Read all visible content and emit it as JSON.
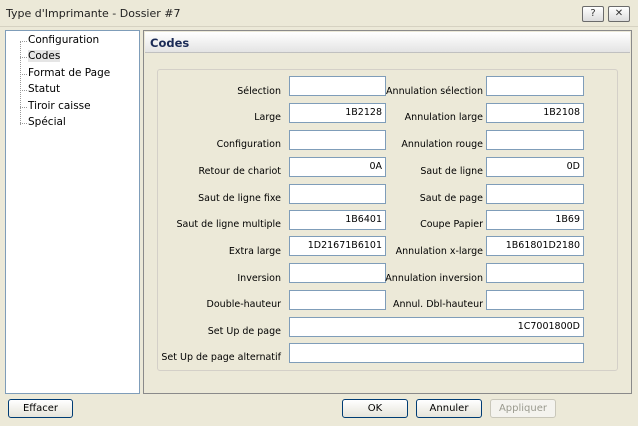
{
  "window": {
    "title": "Type d'Imprimante - Dossier #7",
    "help_label": "?",
    "close_label": "✕"
  },
  "tree": {
    "items": [
      "Configuration",
      "Codes",
      "Format de Page",
      "Statut",
      "Tiroir caisse",
      "Spécial"
    ]
  },
  "panel": {
    "title": "Codes"
  },
  "fields": {
    "selection": {
      "label": "Sélection",
      "value": ""
    },
    "annulation_selection": {
      "label": "Annulation sélection",
      "value": ""
    },
    "large": {
      "label": "Large",
      "value": "1B2128"
    },
    "annulation_large": {
      "label": "Annulation large",
      "value": "1B2108"
    },
    "configuration": {
      "label": "Configuration",
      "value": ""
    },
    "annulation_rouge": {
      "label": "Annulation rouge",
      "value": ""
    },
    "retour_chariot": {
      "label": "Retour de chariot",
      "value": "0A"
    },
    "saut_ligne": {
      "label": "Saut de ligne",
      "value": "0D"
    },
    "saut_ligne_fixe": {
      "label": "Saut de ligne fixe",
      "value": ""
    },
    "saut_page": {
      "label": "Saut de page",
      "value": ""
    },
    "saut_ligne_multiple": {
      "label": "Saut de ligne multiple",
      "value": "1B6401"
    },
    "coupe_papier": {
      "label": "Coupe Papier",
      "value": "1B69"
    },
    "extra_large": {
      "label": "Extra large",
      "value": "1D21671B6101"
    },
    "annulation_xlarge": {
      "label": "Annulation x-large",
      "value": "1B61801D2180"
    },
    "inversion": {
      "label": "Inversion",
      "value": ""
    },
    "annulation_inversion": {
      "label": "Annulation inversion",
      "value": ""
    },
    "double_hauteur": {
      "label": "Double-hauteur",
      "value": ""
    },
    "annul_dbl_hauteur": {
      "label": "Annul. Dbl-hauteur",
      "value": ""
    },
    "setup_page": {
      "label": "Set Up de page",
      "value": "1C7001800D"
    },
    "setup_page_alt": {
      "label": "Set Up de page alternatif",
      "value": ""
    }
  },
  "buttons": {
    "effacer": "Effacer",
    "ok": "OK",
    "annuler": "Annuler",
    "appliquer": "Appliquer"
  }
}
